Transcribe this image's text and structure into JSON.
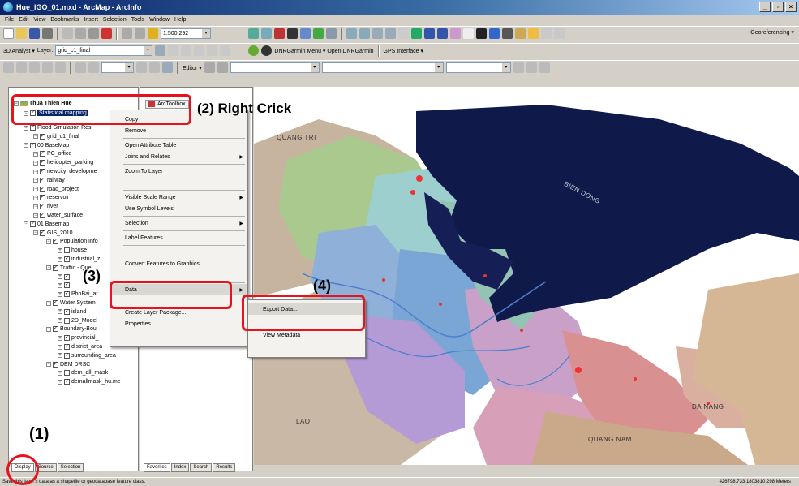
{
  "window": {
    "title": "Hue_IGO_01.mxd - ArcMap - ArcInfo"
  },
  "menubar": [
    "File",
    "Edit",
    "View",
    "Bookmarks",
    "Insert",
    "Selection",
    "Tools",
    "Window",
    "Help"
  ],
  "toolbar1": {
    "scale": "1:500,292",
    "georef_label": "Georeferencing ▾"
  },
  "toolbar2": {
    "analyst": "3D Analyst ▾",
    "layer_label": "Layer:",
    "layer_value": "grid_c1_final",
    "dnr_menu": "DNRGarmin Menu ▾ Open DNRGarmin",
    "gps": "GPS Interface ▾"
  },
  "toolbar3": {
    "editor": "Editor ▾"
  },
  "toc": {
    "root": "Thua Thien Hue",
    "items": [
      {
        "label": "Statistical mapping",
        "level": 1,
        "checked": true,
        "selected": true
      },
      {
        "label": "Flood Simulation Res",
        "level": 1,
        "checked": true
      },
      {
        "label": "grid_c1_final",
        "level": 2,
        "checked": true
      },
      {
        "label": "00 BaseMap",
        "level": 1,
        "checked": true
      },
      {
        "label": "PC_office",
        "level": 2,
        "checked": true
      },
      {
        "label": "helicopter_parking",
        "level": 2,
        "checked": true
      },
      {
        "label": "newcity_developme",
        "level": 2,
        "checked": true
      },
      {
        "label": "railway",
        "level": 2,
        "checked": true
      },
      {
        "label": "road_project",
        "level": 2,
        "checked": true
      },
      {
        "label": "reservoir",
        "level": 2,
        "checked": true
      },
      {
        "label": "river",
        "level": 2,
        "checked": true
      },
      {
        "label": "water_surface",
        "level": 2,
        "checked": true
      },
      {
        "label": "01 Basemap",
        "level": 1,
        "checked": true
      },
      {
        "label": "GIS_2010",
        "level": 2,
        "checked": true
      },
      {
        "label": "Population Info",
        "level": 3,
        "checked": true
      },
      {
        "label": "house",
        "level": 4,
        "checked": false
      },
      {
        "label": "industrial_z",
        "level": 4,
        "checked": true
      },
      {
        "label": "Traffic - Que",
        "level": 3,
        "checked": true
      },
      {
        "label": "",
        "level": 4,
        "checked": true
      },
      {
        "label": "",
        "level": 4,
        "checked": true
      },
      {
        "label": "PhoBai_ar",
        "level": 4,
        "checked": true
      },
      {
        "label": "Water System",
        "level": 3,
        "checked": true
      },
      {
        "label": "island",
        "level": 4,
        "checked": true
      },
      {
        "label": "2D_Model",
        "level": 4,
        "checked": false
      },
      {
        "label": "Boundary-Bou",
        "level": 3,
        "checked": true
      },
      {
        "label": "provincial_",
        "level": 4,
        "checked": true
      },
      {
        "label": "district_area",
        "level": 4,
        "checked": true
      },
      {
        "label": "surrounding_area",
        "level": 4,
        "checked": true
      },
      {
        "label": "DEM DRSC",
        "level": 3,
        "checked": true
      },
      {
        "label": "dem_all_mask",
        "level": 4,
        "checked": false
      },
      {
        "label": "demallmask_hu.me",
        "level": 4,
        "checked": true
      }
    ],
    "tabs": [
      "Display",
      "Source",
      "Selection"
    ]
  },
  "toolbox": {
    "title": "ArcToolbox",
    "tabs": [
      "Favorites",
      "Index",
      "Search",
      "Results"
    ]
  },
  "context_menu": [
    {
      "label": "Copy",
      "sep_after": false
    },
    {
      "label": "Remove",
      "sep_after": true
    },
    {
      "label": "Open Attribute Table",
      "sep_after": false
    },
    {
      "label": "Joins and Relates",
      "arrow": true,
      "sep_after": true
    },
    {
      "label": "Zoom To Layer",
      "sep_after": false
    },
    {
      "label": "",
      "sep_after": true
    },
    {
      "label": "Visible Scale Range",
      "arrow": true,
      "sep_after": false
    },
    {
      "label": "Use Symbol Levels",
      "sep_after": true
    },
    {
      "label": "Selection",
      "arrow": true,
      "sep_after": true
    },
    {
      "label": "Label Features",
      "sep_after": true
    },
    {
      "label": "",
      "sep_after": false
    },
    {
      "label": "Convert Features to Graphics...",
      "sep_after": false
    },
    {
      "label": "",
      "sep_after": true
    },
    {
      "label": "Data",
      "arrow": true,
      "sep_after": false
    },
    {
      "label": "",
      "sep_after": false
    },
    {
      "label": "Create Layer Package...",
      "sep_after": false
    },
    {
      "label": "Properties...",
      "sep_after": false
    }
  ],
  "submenu": [
    {
      "label": "Export Data..."
    },
    {
      "label": ""
    },
    {
      "label": "View Metadata"
    },
    {
      "label": ""
    }
  ],
  "map": {
    "labels": [
      "QUANG TRI",
      "BIEN DONG",
      "LAO",
      "DA NANG",
      "QUANG NAM"
    ]
  },
  "annotations": {
    "step1": "(1)",
    "step2": "(2) Right Crick",
    "step3": "(3)",
    "step4": "(4)"
  },
  "statusbar": {
    "text": "Save this layer's data as a shapefile or geodatabase feature class.",
    "coords": "426798.733  1803810.298 Meters"
  },
  "colors": {
    "annotation_red": "#e8121c",
    "sea": "#0f1a4a",
    "title_bar": "#0a246a"
  }
}
